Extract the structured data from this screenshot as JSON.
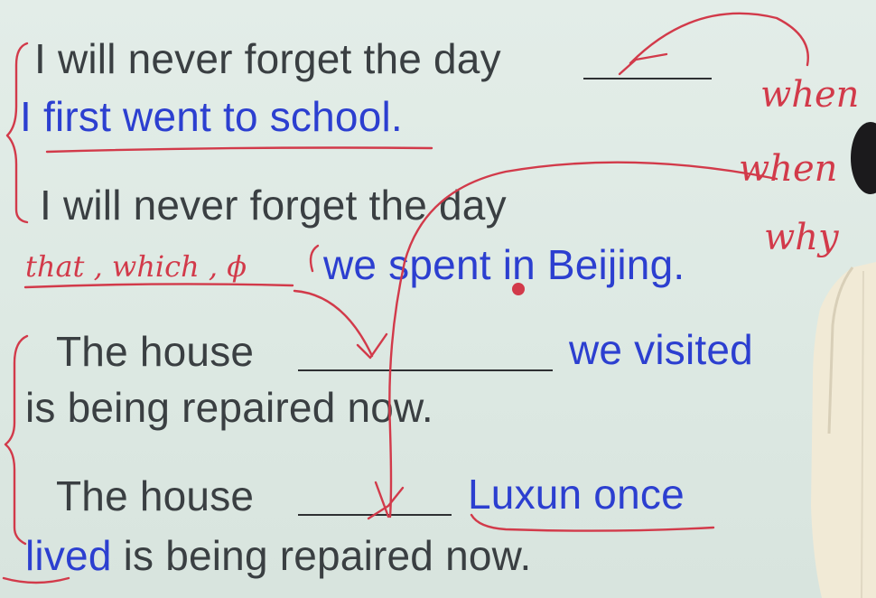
{
  "lines": {
    "s1_a": "I will never forget the day",
    "s1_b": "I first went to school.",
    "s2_a": "I will never forget the day",
    "s2_b": "we spent in Beijing.",
    "s3_a": "The house",
    "s3_b": "we  visited",
    "s3_c": "is being repaired now.",
    "s4_a": "The house",
    "s4_b": "Luxun once",
    "s4_c": "lived",
    "s4_d": " is being repaired now."
  },
  "handwriting": {
    "side_words": [
      "when",
      "when",
      "why"
    ],
    "answer_line": "that , which , ϕ"
  },
  "colors": {
    "text": "#3a3f42",
    "blue": "#2c3fd0",
    "ink": "#d23a4a"
  }
}
